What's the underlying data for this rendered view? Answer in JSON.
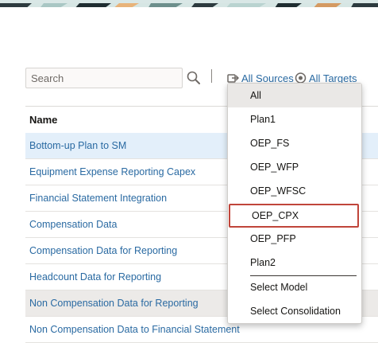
{
  "toolbar": {
    "search_placeholder": "Search",
    "all_sources": "All Sources",
    "all_targets": "All Targets"
  },
  "table": {
    "column_name": "Name",
    "rows": [
      "Bottom-up Plan to SM",
      "Equipment Expense Reporting Capex",
      "Financial Statement Integration",
      "Compensation Data",
      "Compensation Data for Reporting",
      "Headcount Data for Reporting",
      "Non Compensation Data for Reporting",
      "Non Compensation Data to Financial Statement"
    ]
  },
  "dropdown": {
    "options": [
      "All",
      "Plan1",
      "OEP_FS",
      "OEP_WFP",
      "OEP_WFSC",
      "OEP_CPX",
      "OEP_PFP",
      "Plan2"
    ],
    "extra": [
      "Select Model",
      "Select Consolidation"
    ]
  },
  "colors": {
    "link": "#2a6aa2",
    "selected_row": "#e3effa",
    "highlight_border": "#c0453a"
  }
}
